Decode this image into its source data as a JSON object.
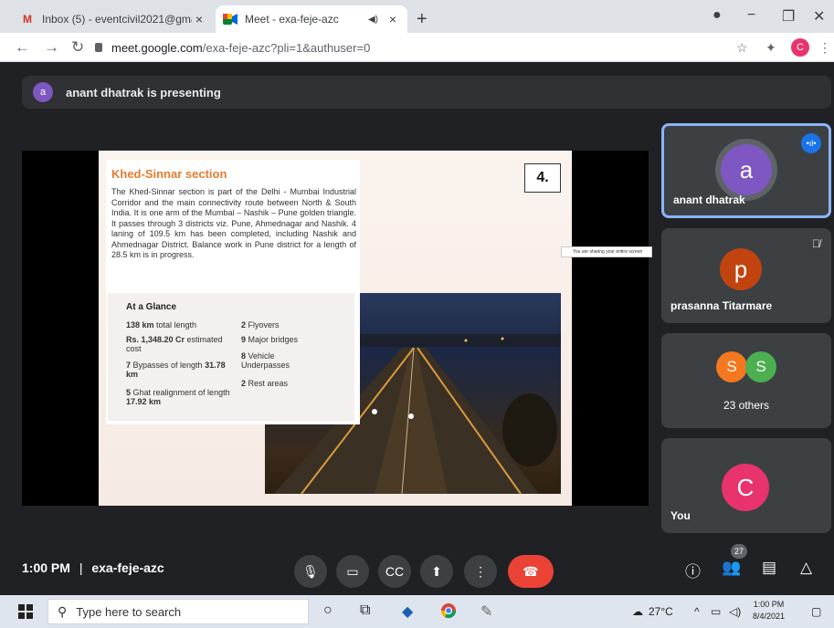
{
  "browser": {
    "tabs": [
      {
        "title": "Inbox (5) - eventcivil2021@gmai",
        "icon": "gmail-icon",
        "active": false
      },
      {
        "title": "Meet - exa-feje-azc",
        "icon": "meet-icon",
        "active": true
      }
    ],
    "url_host": "meet.google.com",
    "url_path": "/exa-feje-azc?pli=1&authuser=0",
    "profile_initial": "C"
  },
  "meet": {
    "presenting_initial": "a",
    "presenting_text": "anant dhatrak is presenting",
    "slide": {
      "title": "Khed-Sinnar section",
      "number": "4.",
      "paragraph": "The Khed-Sinnar section is part of the Delhi - Mumbai Industrial Corridor and the main connectivity route between North & South India. It is one arm of the Mumbai – Nashik – Pune golden triangle. It passes through 3 districts viz. Pune, Ahmednagar and Nashik. 4 laning of 109.5 km has been completed, including Nashik and Ahmednagar District. Balance work in Pune district for a length of 28.5 km is in progress.",
      "glance_title": "At a Glance",
      "col1": [
        {
          "bold": "138 km",
          "text": " total length"
        },
        {
          "bold": "Rs. 1,348.20 Cr",
          "text": " estimated cost"
        },
        {
          "bold": "7",
          "text": " Bypasses of length ",
          "bold2": "31.78 km"
        },
        {
          "bold": "5",
          "text": " Ghat realignment of length ",
          "bold2": "17.92 km"
        }
      ],
      "col2": [
        {
          "bold": "2",
          "text": " Flyovers"
        },
        {
          "bold": "9",
          "text": " Major bridges"
        },
        {
          "bold": "8",
          "text": " Vehicle Underpasses"
        },
        {
          "bold": "2",
          "text": " Rest areas"
        }
      ]
    },
    "share_tip": "You are sharing your entire screen",
    "participants": [
      {
        "initial": "a",
        "name": "anant dhatrak",
        "color": "#7e57c2",
        "speaking": true
      },
      {
        "initial": "p",
        "name": "prasanna Titarmare",
        "color": "#c1440e",
        "muted": true
      },
      {
        "group": true,
        "initials": [
          "S",
          "S"
        ],
        "colors": [
          "#f4781f",
          "#4caf50"
        ],
        "label": "23 others"
      },
      {
        "initial": "C",
        "name": "You",
        "color": "#e8336d"
      }
    ],
    "time": "1:00 PM",
    "separator": "|",
    "meeting_code": "exa-feje-azc",
    "people_count": "27"
  },
  "taskbar": {
    "search_placeholder": "Type here to search",
    "weather": "27°C",
    "time": "1:00 PM",
    "date": "8/4/2021"
  }
}
